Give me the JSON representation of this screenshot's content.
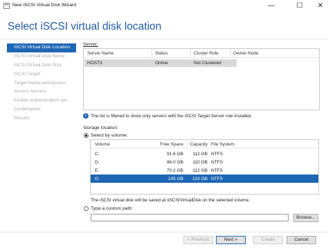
{
  "window": {
    "title": "New iSCSI Virtual Disk Wizard",
    "minimize_glyph": "—",
    "maximize_glyph": "☐",
    "close_glyph": "✕"
  },
  "page_title": "Select iSCSI virtual disk location",
  "nav": {
    "items": [
      {
        "label": "iSCSI Virtual Disk Location",
        "state": "active"
      },
      {
        "label": "iSCSI Virtual Disk Name",
        "state": "pending"
      },
      {
        "label": "iSCSI Virtual Disk Size",
        "state": "pending"
      },
      {
        "label": "iSCSI Target",
        "state": "pending"
      },
      {
        "label": "Target Name and Access",
        "state": "pending"
      },
      {
        "label": "Access Servers",
        "state": "pending"
      },
      {
        "label": "Enable authentication ser...",
        "state": "pending"
      },
      {
        "label": "Confirmation",
        "state": "pending"
      },
      {
        "label": "Results",
        "state": "pending"
      }
    ]
  },
  "server_section": {
    "label": "Server:",
    "columns": [
      "Server Name",
      "Status",
      "Cluster Role",
      "Owner Node"
    ],
    "rows": [
      {
        "server_name": "HOST3",
        "status": "Online",
        "cluster_role": "Not Clustered",
        "owner_node": ""
      }
    ],
    "filter_note": "The list is filtered to show only servers with the iSCSI Target Server role installed."
  },
  "storage_section": {
    "label": "Storage location:",
    "select_by_volume_label": "Select by volume:",
    "columns": [
      "Volume",
      "Free Space",
      "Capacity",
      "File System"
    ],
    "volumes": [
      {
        "volume": "C:",
        "free_space": "91.6 GB",
        "capacity": "112 GB",
        "file_system": "NTFS",
        "selected": false
      },
      {
        "volume": "D:",
        "free_space": "86.0 GB",
        "capacity": "110 GB",
        "file_system": "NTFS",
        "selected": false
      },
      {
        "volume": "E:",
        "free_space": "70.2 GB",
        "capacity": "112 GB",
        "file_system": "NTFS",
        "selected": false
      },
      {
        "volume": "G:",
        "free_space": "105 GB",
        "capacity": "123 GB",
        "file_system": "NTFS",
        "selected": true
      }
    ],
    "save_note": "The iSCSI virtual disk will be saved at \\iSCSIVirtualDisk on the selected volume.",
    "custom_path_label": "Type a custom path:",
    "custom_path_value": "",
    "browse_label": "Browse..."
  },
  "footer": {
    "previous_label": "< Previous",
    "next_label": "Next >",
    "create_label": "Create",
    "cancel_label": "Cancel"
  },
  "colors": {
    "accent": "#1d66b5",
    "title": "#1f5aa6",
    "selected_row": "#d9d9d9"
  }
}
